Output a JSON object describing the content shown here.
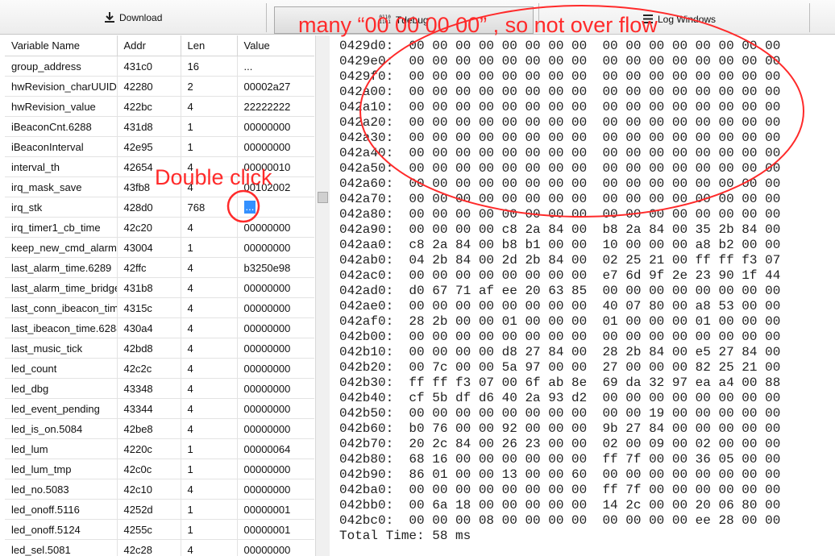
{
  "toolbar": {
    "download_label": "Download",
    "tdebug_label": "Tdebug",
    "tdebug_icon_text": "0110\n1101",
    "log_windows_label": "Log Windows"
  },
  "variables": {
    "columns": [
      "Variable Name",
      "Addr",
      "Len",
      "Value"
    ],
    "rows": [
      [
        "group_address",
        "431c0",
        "16",
        "..."
      ],
      [
        "hwRevision_charUUID",
        "42280",
        "2",
        "00002a27"
      ],
      [
        "hwRevision_value",
        "422bc",
        "4",
        "22222222"
      ],
      [
        "iBeaconCnt.6288",
        "431d8",
        "1",
        "00000000"
      ],
      [
        "iBeaconInterval",
        "42e95",
        "1",
        "00000000"
      ],
      [
        "interval_th",
        "42654",
        "4",
        "00000010"
      ],
      [
        "irq_mask_save",
        "43fb8",
        "4",
        "00102002"
      ],
      [
        "irq_stk",
        "428d0",
        "768",
        "..."
      ],
      [
        "irq_timer1_cb_time",
        "42c20",
        "4",
        "00000000"
      ],
      [
        "keep_new_cmd_alarm",
        "43004",
        "1",
        "00000000"
      ],
      [
        "last_alarm_time.6289",
        "42ffc",
        "4",
        "b3250e98"
      ],
      [
        "last_alarm_time_bridge",
        "431b8",
        "4",
        "00000000"
      ],
      [
        "last_conn_ibeacon_time",
        "4315c",
        "4",
        "00000000"
      ],
      [
        "last_ibeacon_time.6288",
        "430a4",
        "4",
        "00000000"
      ],
      [
        "last_music_tick",
        "42bd8",
        "4",
        "00000000"
      ],
      [
        "led_count",
        "42c2c",
        "4",
        "00000000"
      ],
      [
        "led_dbg",
        "43348",
        "4",
        "00000000"
      ],
      [
        "led_event_pending",
        "43344",
        "4",
        "00000000"
      ],
      [
        "led_is_on.5084",
        "42be8",
        "4",
        "00000000"
      ],
      [
        "led_lum",
        "4220c",
        "1",
        "00000064"
      ],
      [
        "led_lum_tmp",
        "42c0c",
        "1",
        "00000000"
      ],
      [
        "led_no.5083",
        "42c10",
        "4",
        "00000000"
      ],
      [
        "led_onoff.5116",
        "4252d",
        "1",
        "00000001"
      ],
      [
        "led_onoff.5124",
        "4255c",
        "1",
        "00000001"
      ],
      [
        "led_sel.5081",
        "42c28",
        "4",
        "00000000"
      ]
    ]
  },
  "memory": {
    "lines": [
      "0429d0:  00 00 00 00 00 00 00 00  00 00 00 00 00 00 00 00",
      "0429e0:  00 00 00 00 00 00 00 00  00 00 00 00 00 00 00 00",
      "0429f0:  00 00 00 00 00 00 00 00  00 00 00 00 00 00 00 00",
      "042a00:  00 00 00 00 00 00 00 00  00 00 00 00 00 00 00 00",
      "042a10:  00 00 00 00 00 00 00 00  00 00 00 00 00 00 00 00",
      "042a20:  00 00 00 00 00 00 00 00  00 00 00 00 00 00 00 00",
      "042a30:  00 00 00 00 00 00 00 00  00 00 00 00 00 00 00 00",
      "042a40:  00 00 00 00 00 00 00 00  00 00 00 00 00 00 00 00",
      "042a50:  00 00 00 00 00 00 00 00  00 00 00 00 00 00 00 00",
      "042a60:  00 00 00 00 00 00 00 00  00 00 00 00 00 00 00 00",
      "042a70:  00 00 00 00 00 00 00 00  00 00 00 00 00 00 00 00",
      "042a80:  00 00 00 00 00 00 00 00  00 00 00 00 00 00 00 00",
      "042a90:  00 00 00 00 c8 2a 84 00  b8 2a 84 00 35 2b 84 00",
      "042aa0:  c8 2a 84 00 b8 b1 00 00  10 00 00 00 a8 b2 00 00",
      "042ab0:  04 2b 84 00 2d 2b 84 00  02 25 21 00 ff ff f3 07",
      "042ac0:  00 00 00 00 00 00 00 00  e7 6d 9f 2e 23 90 1f 44",
      "042ad0:  d0 67 71 af ee 20 63 85  00 00 00 00 00 00 00 00",
      "042ae0:  00 00 00 00 00 00 00 00  40 07 80 00 a8 53 00 00",
      "042af0:  28 2b 00 00 01 00 00 00  01 00 00 00 01 00 00 00",
      "042b00:  00 00 00 00 00 00 00 00  00 00 00 00 00 00 00 00",
      "042b10:  00 00 00 00 d8 27 84 00  28 2b 84 00 e5 27 84 00",
      "042b20:  00 7c 00 00 5a 97 00 00  27 00 00 00 82 25 21 00",
      "042b30:  ff ff f3 07 00 6f ab 8e  69 da 32 97 ea a4 00 88",
      "042b40:  cf 5b df d6 40 2a 93 d2  00 00 00 00 00 00 00 00",
      "042b50:  00 00 00 00 00 00 00 00  00 00 19 00 00 00 00 00",
      "042b60:  b0 76 00 00 92 00 00 00  9b 27 84 00 00 00 00 00",
      "042b70:  20 2c 84 00 26 23 00 00  02 00 09 00 02 00 00 00",
      "042b80:  68 16 00 00 00 00 00 00  ff 7f 00 00 36 05 00 00",
      "042b90:  86 01 00 00 13 00 00 60  00 00 00 00 00 00 00 00",
      "042ba0:  00 00 00 00 00 00 00 00  ff 7f 00 00 00 00 00 00",
      "042bb0:  00 6a 18 00 00 00 00 00  14 2c 00 00 20 06 80 00",
      "042bc0:  00 00 00 08 00 00 00 00  00 00 00 00 ee 28 00 00"
    ],
    "total_time": "Total Time: 58 ms"
  },
  "annotations": {
    "many_text": "many  “00 00 00 00”  , so not over flow",
    "double_click_text": "Double click",
    "color": "#ff2a2a"
  }
}
